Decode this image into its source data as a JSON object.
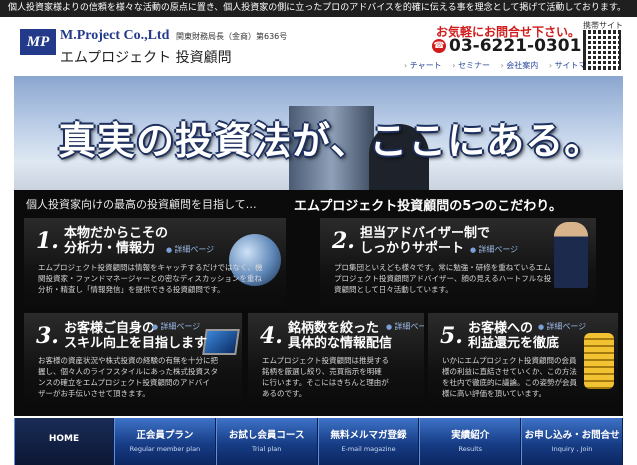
{
  "topbar": {
    "text": "個人投資家様よりの信頼を様々な活動の原点に置き、個人投資家の側に立ったプロのアドバイスを的確に伝える事を理念として掲げて活動しております。"
  },
  "header": {
    "logo_mark": "MP",
    "company_en": "M.Project Co.,Ltd",
    "registration": "関東財務局長（金商）第636号",
    "company_jp": "エムプロジェクト 投資顧問",
    "contact_caption": "お気軽にお問合せ下さい。",
    "phone": "03-6221-0301",
    "phone_icon": "phone-icon",
    "nav": [
      "チャート",
      "セミナー",
      "会社案内",
      "サイトマップ"
    ],
    "qr_label": "携帯サイト"
  },
  "hero": {
    "headline": "真実の投資法が、ここにある。"
  },
  "intro": {
    "left": "個人投資家向けの最高の投資顧問を目指して…",
    "right": "エムプロジェクト投資顧問の5つのこだわり。"
  },
  "cards": [
    {
      "num": "1.",
      "title1": "本物だからこその",
      "title2": "分析力・情報力",
      "more": "詳細ページ",
      "desc": [
        "エムプロジェクト投資顧問は情報をキャッチするだけではなく、機",
        "関投資家・ファンドマネージャーとの密なディスカッションを重ね",
        "分析・精査し「情報発信」を提供できる投資顧問です。"
      ]
    },
    {
      "num": "2.",
      "title1": "担当アドバイザー制で",
      "title2": "しっかりサポート",
      "more": "詳細ページ",
      "desc": [
        "プロ集団といえども様々です。常に勉強・研修を重ねているエム",
        "プロジェクト投資顧問アドバイザー、顔の見えるハートフルな投",
        "資顧問として日々活動しています。"
      ]
    },
    {
      "num": "3.",
      "title1": "お客様ご自身の",
      "title2": "スキル向上を目指します",
      "more": "詳細ページ",
      "desc": [
        "お客様の資産状況や株式投資の経験の有無を十分に把",
        "握し、個々人のライフスタイルにあった株式投資スタ",
        "ンスの確立をエムプロジェクト投資顧問のアドバイ",
        "ザーがお手伝いさせて頂きます。"
      ]
    },
    {
      "num": "4.",
      "title1": "銘柄数を絞った",
      "title2": "具体的な情報配信",
      "more": "詳細ページ",
      "desc": [
        "エムプロジェクト投資顧問は推奨する",
        "銘柄を厳選し絞り、売買指示を明確",
        "に行います。そこにはきちんと理由が",
        "あるのです。"
      ]
    },
    {
      "num": "5.",
      "title1": "お客様への",
      "title2": "利益還元を徹底",
      "more": "詳細ページ",
      "desc": [
        "いかにエムプロジェクト投資顧問の会員",
        "様の利益に直結させていくか、この方法",
        "を社内で徹底的に議論。この姿勢が会員",
        "様に高い評価を頂いています。"
      ]
    }
  ],
  "nav": [
    {
      "jp": "HOME",
      "en": ""
    },
    {
      "jp": "正会員プラン",
      "en": "Regular member plan"
    },
    {
      "jp": "お試し会員コース",
      "en": "Trial plan"
    },
    {
      "jp": "無料メルマガ登録",
      "en": "E-mail magazine"
    },
    {
      "jp": "実績紹介",
      "en": "Results"
    },
    {
      "jp": "お申し込み・お問合せ",
      "en": "Inquiry , Join"
    }
  ],
  "colors": {
    "brand": "#23398a",
    "accent_red": "#d11a1a",
    "nav_blue": "#173d86"
  }
}
